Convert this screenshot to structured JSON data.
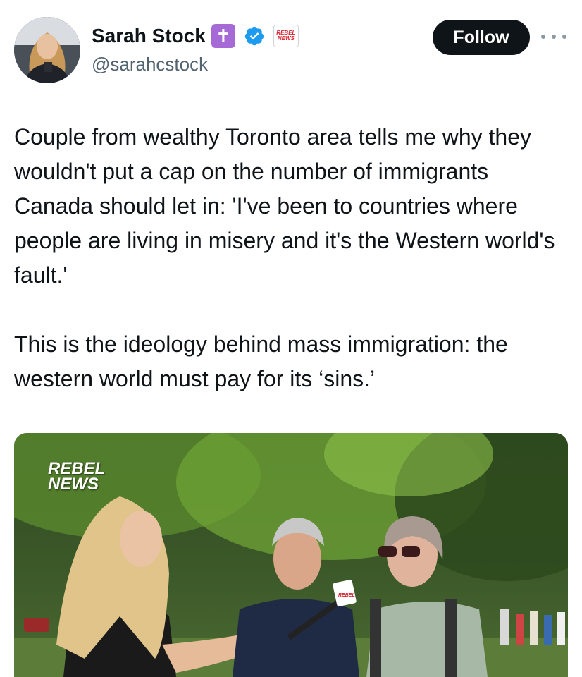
{
  "author": {
    "display_name": "Sarah Stock",
    "badge_symbol": "✝",
    "handle": "@sarahcstock",
    "verified": true,
    "affiliate_badge_text": "REBEL NEWS"
  },
  "actions": {
    "follow_label": "Follow",
    "more_icon": "more-horizontal-icon"
  },
  "tweet": {
    "text": "Couple from wealthy Toronto area tells me why they wouldn't put a cap on the number of immigrants Canada should let in: 'I've been to countries where people are living in misery and it's the Western world's fault.'\n\nThis is the ideology behind mass immigration: the western world must pay for its ‘sins.’"
  },
  "media": {
    "watermark_line1": "REBEL",
    "watermark_line2": "NEWS",
    "mic_flag_text": "REBEL"
  },
  "colors": {
    "follow_bg": "#0f1419",
    "verified": "#1d9bf0",
    "cross_badge": "#a66ad6",
    "brand_red": "#d22630"
  }
}
